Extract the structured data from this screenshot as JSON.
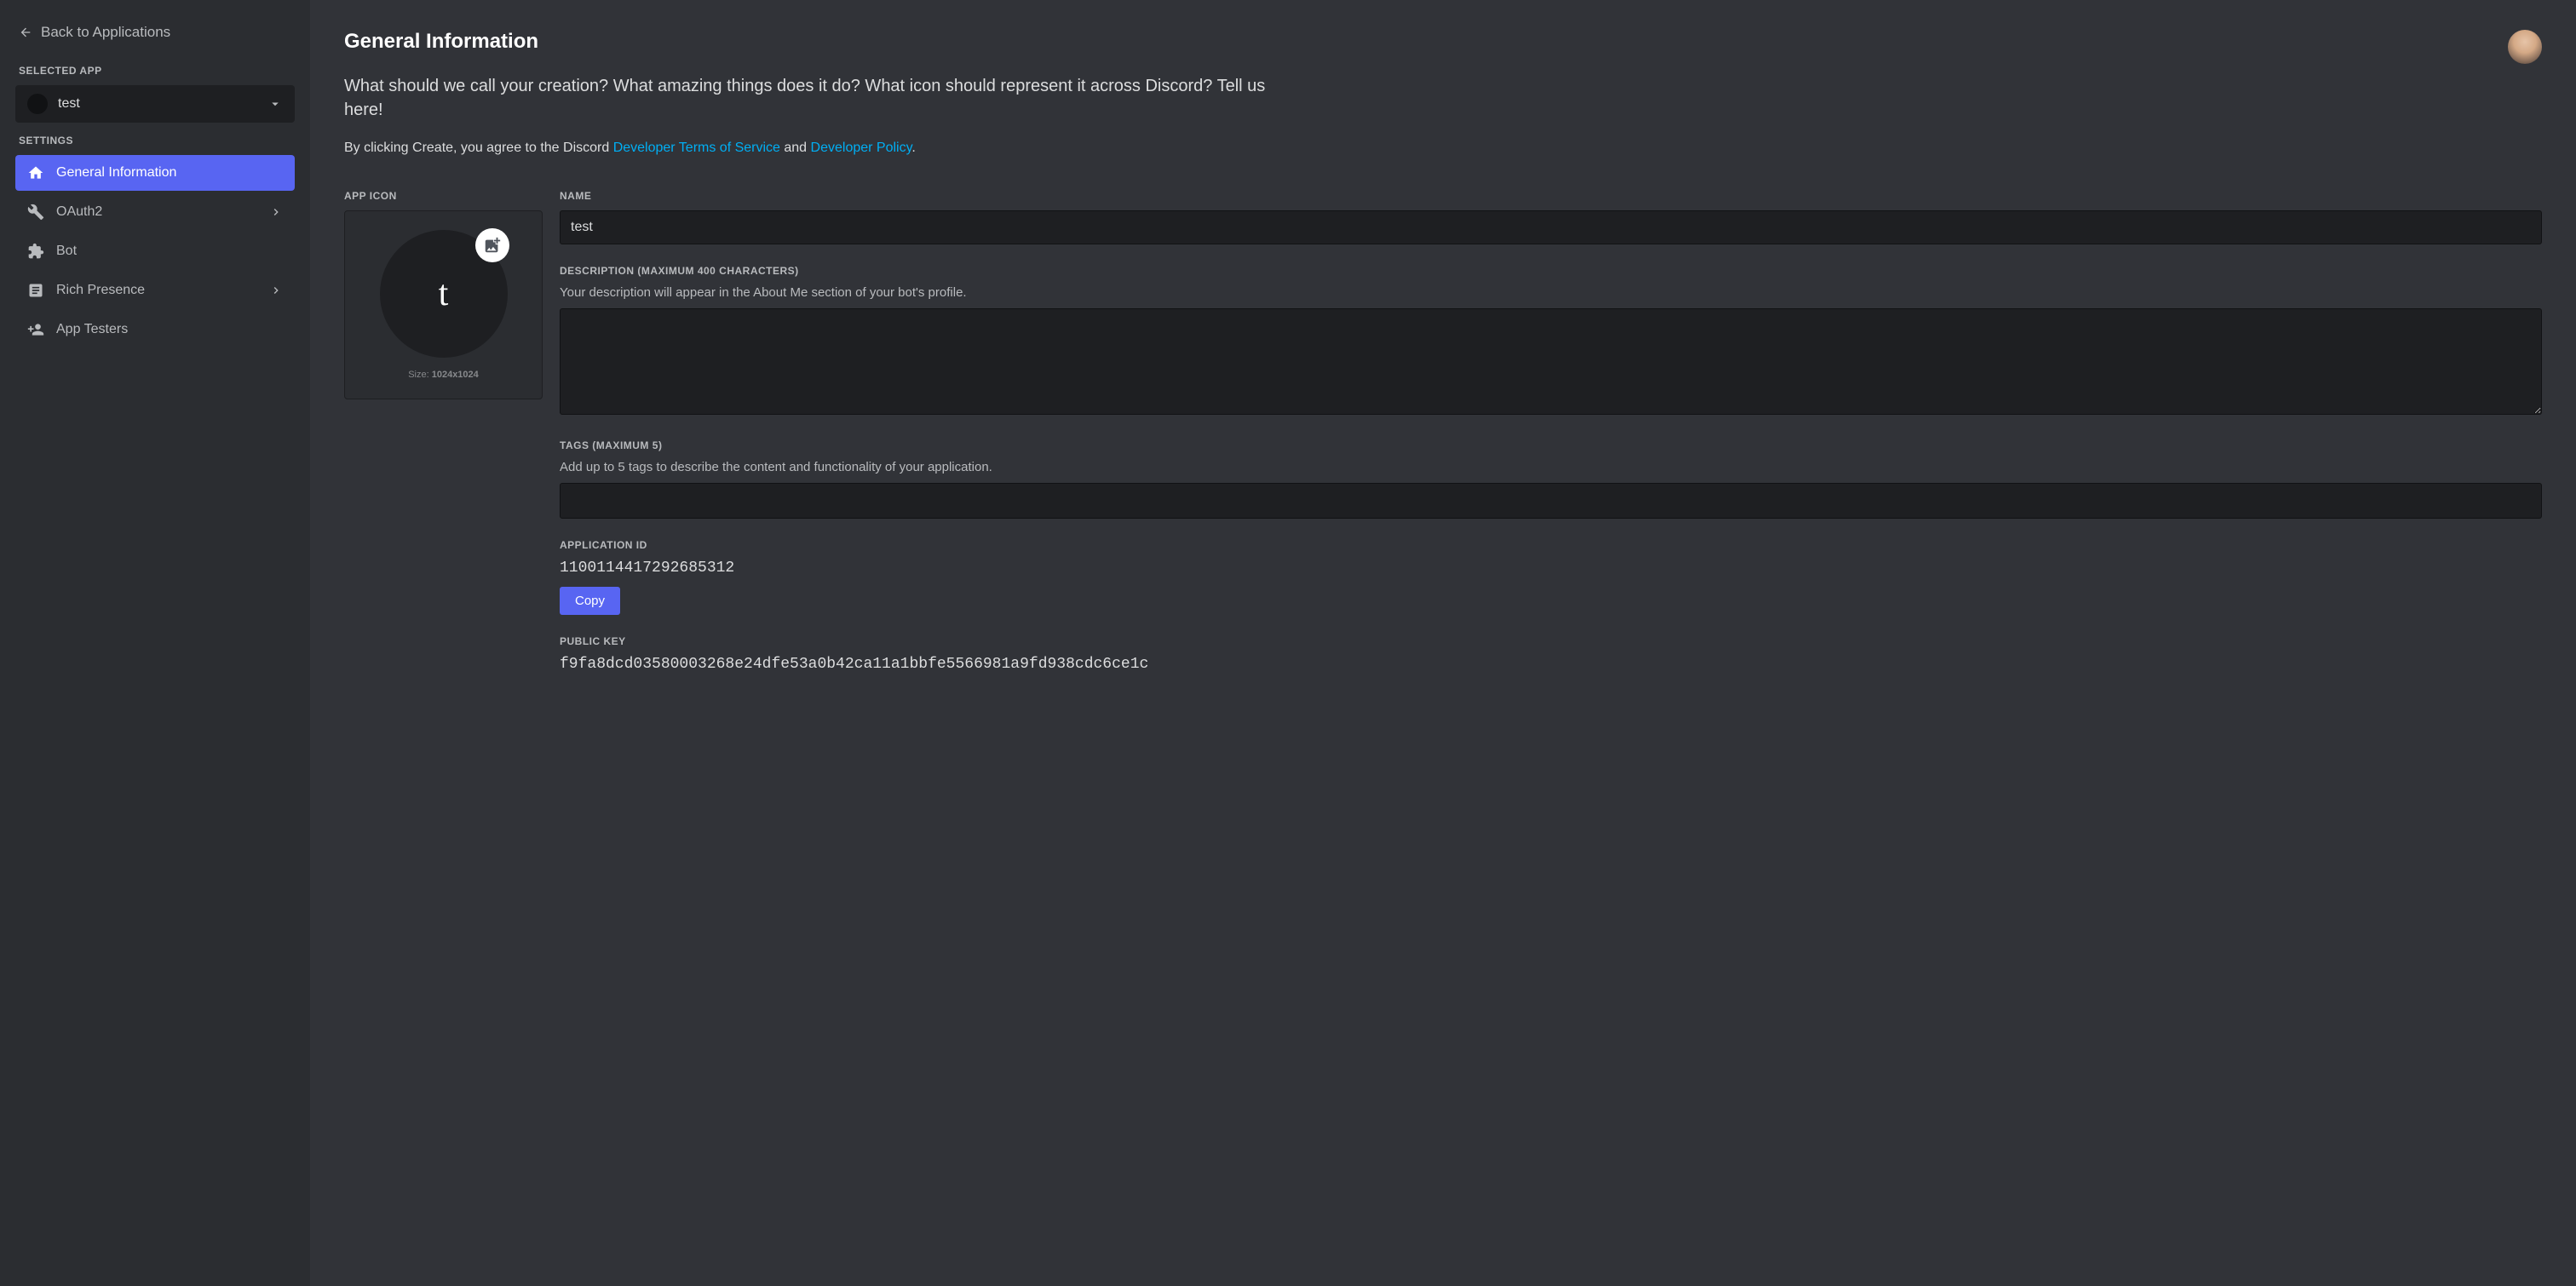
{
  "sidebar": {
    "back_label": "Back to Applications",
    "selected_app_label": "SELECTED APP",
    "selected_app_name": "test",
    "settings_label": "SETTINGS",
    "nav": [
      {
        "label": "General Information",
        "active": true,
        "has_sub": false
      },
      {
        "label": "OAuth2",
        "active": false,
        "has_sub": true
      },
      {
        "label": "Bot",
        "active": false,
        "has_sub": false
      },
      {
        "label": "Rich Presence",
        "active": false,
        "has_sub": true
      },
      {
        "label": "App Testers",
        "active": false,
        "has_sub": false
      }
    ]
  },
  "page": {
    "title": "General Information",
    "subtitle": "What should we call your creation? What amazing things does it do? What icon should represent it across Discord? Tell us here!",
    "terms_prefix": "By clicking Create, you agree to the Discord ",
    "terms_link1": "Developer Terms of Service",
    "terms_mid": " and ",
    "terms_link2": "Developer Policy",
    "terms_suffix": "."
  },
  "form": {
    "app_icon_label": "APP ICON",
    "app_icon_letter": "t",
    "size_prefix": "Size: ",
    "size_value": "1024x1024",
    "name_label": "NAME",
    "name_value": "test",
    "description_label": "DESCRIPTION (MAXIMUM 400 CHARACTERS)",
    "description_hint": "Your description will appear in the About Me section of your bot's profile.",
    "description_value": "",
    "tags_label": "TAGS (MAXIMUM 5)",
    "tags_hint": "Add up to 5 tags to describe the content and functionality of your application.",
    "app_id_label": "APPLICATION ID",
    "app_id_value": "1100114417292685312",
    "copy_label": "Copy",
    "public_key_label": "PUBLIC KEY",
    "public_key_value": "f9fa8dcd03580003268e24dfe53a0b42ca11a1bbfe5566981a9fd938cdc6ce1c"
  }
}
